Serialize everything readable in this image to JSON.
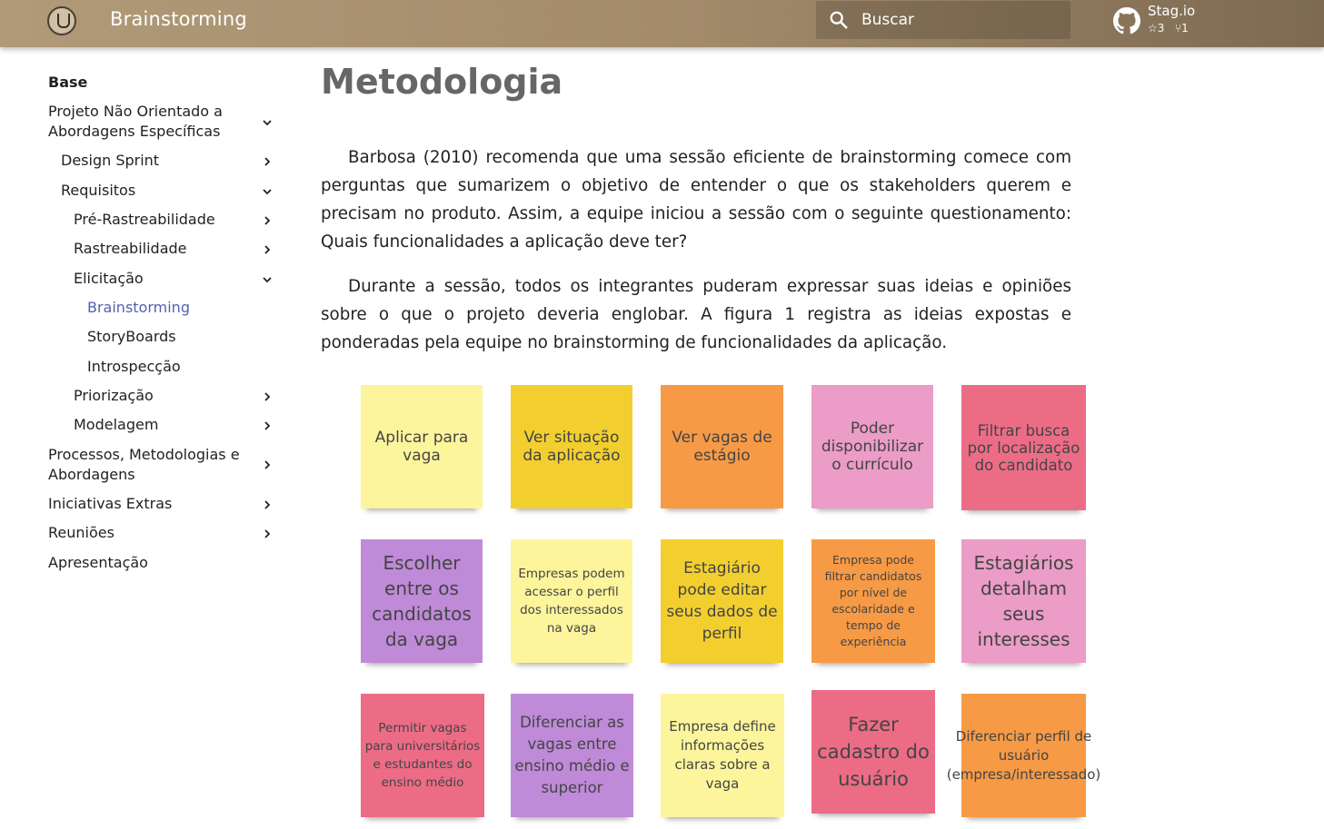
{
  "header": {
    "app_title": "Brainstorming",
    "search_placeholder": "Buscar",
    "repo_name": "Stag.io",
    "repo_stars": "3",
    "repo_forks": "1"
  },
  "nav": {
    "items": [
      {
        "label": "Base"
      },
      {
        "label": "Projeto Não Orientado a Abordagens Específicas"
      },
      {
        "label": "Design Sprint"
      },
      {
        "label": "Requisitos"
      },
      {
        "label": "Pré-Rastreabilidade"
      },
      {
        "label": "Rastreabilidade"
      },
      {
        "label": "Elicitação"
      },
      {
        "label": "Brainstorming"
      },
      {
        "label": "StoryBoards"
      },
      {
        "label": "Introspecção"
      },
      {
        "label": "Priorização"
      },
      {
        "label": "Modelagem"
      },
      {
        "label": "Processos, Metodologias e Abordagens"
      },
      {
        "label": "Iniciativas Extras"
      },
      {
        "label": "Reuniões"
      },
      {
        "label": "Apresentação"
      }
    ]
  },
  "content": {
    "title": "Metodologia",
    "paragraphs": [
      "Barbosa (2010) recomenda que uma sessão eficiente de brainstorming comece com perguntas que sumarizem o objetivo de entender o que os stakeholders querem e precisam no produto. Assim, a equipe iniciou a sessão com o seguinte questionamento: Quais funcionalidades a aplicação deve ter?",
      "Durante a sessão, todos os integrantes puderam expressar suas ideias e opiniões sobre o que o projeto deveria englobar. A figura 1 registra as ideias expostas e ponderadas pela equipe no brainstorming de funcionalidades da aplicação."
    ]
  },
  "figure": {
    "notes": [
      {
        "text": "Aplicar para vaga",
        "color": "#fdf59c"
      },
      {
        "text": "Ver situação da aplicação",
        "color": "#f2cf2f"
      },
      {
        "text": "Ver vagas de estágio",
        "color": "#f79a45"
      },
      {
        "text": "Poder disponibilizar o currículo",
        "color": "#eb9cc7"
      },
      {
        "text": "Filtrar busca por localização do candidato",
        "color": "#ec6c86"
      },
      {
        "text": "Escolher entre os candidatos da vaga",
        "color": "#bf8ad8"
      },
      {
        "text": "Empresas podem acessar o perfil dos interessados na vaga",
        "color": "#fdf59c"
      },
      {
        "text": "Estagiário pode editar seus dados de perfil",
        "color": "#f2cf2f"
      },
      {
        "text": "Empresa pode filtrar candidatos por nível de escolaridade e tempo de experiência",
        "color": "#f79a45"
      },
      {
        "text": "Estagiários detalham seus interesses",
        "color": "#eb9cc7"
      },
      {
        "text": "Permitir vagas para universitários e estudantes do ensino médio",
        "color": "#ec6c86"
      },
      {
        "text": "Diferenciar as vagas entre ensino médio e superior",
        "color": "#bf8ad8"
      },
      {
        "text": "Empresa define informações claras sobre a vaga",
        "color": "#fdf59c"
      },
      {
        "text": "Fazer cadastro do usuário",
        "color": "#ec6c86"
      },
      {
        "text": "Diferenciar perfil de usuário (empresa/interessado)",
        "color": "#f79a45"
      }
    ]
  }
}
